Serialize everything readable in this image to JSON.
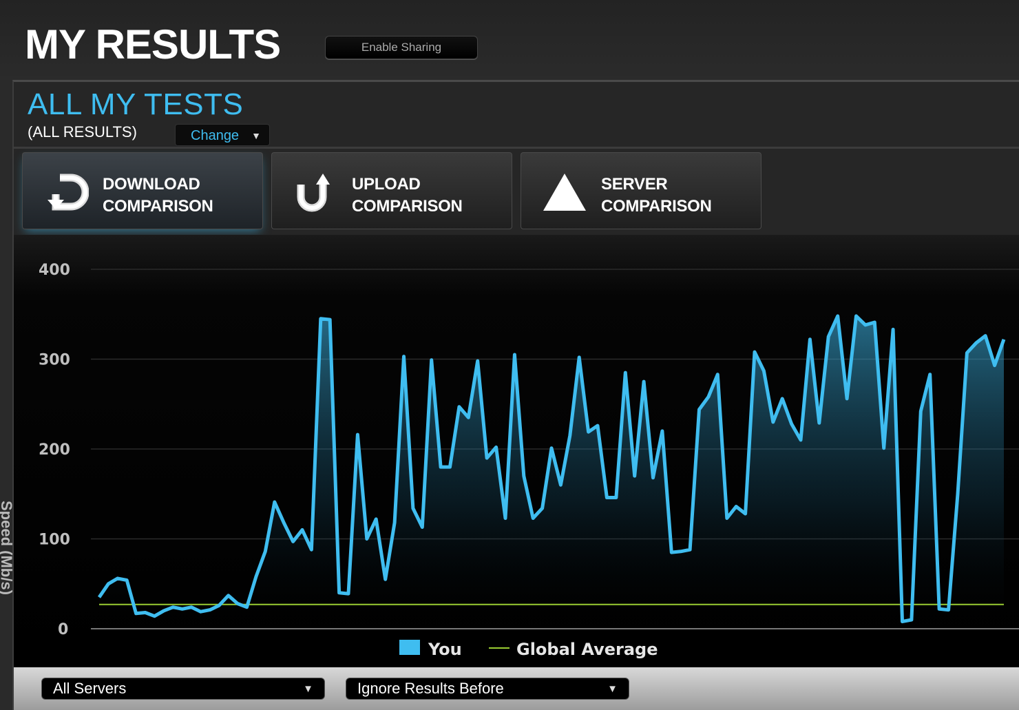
{
  "header": {
    "title": "MY RESULTS",
    "share_label": "Enable Sharing"
  },
  "tests": {
    "title": "ALL MY TESTS",
    "subtitle": "(ALL RESULTS)",
    "change_label": "Change"
  },
  "tabs": [
    {
      "line1": "DOWNLOAD",
      "line2": "COMPARISON",
      "icon": "download-icon"
    },
    {
      "line1": "UPLOAD",
      "line2": "COMPARISON",
      "icon": "upload-icon"
    },
    {
      "line1": "SERVER",
      "line2": "COMPARISON",
      "icon": "triangle-icon"
    }
  ],
  "active_tab": 0,
  "filters": {
    "servers": "All Servers",
    "ignore": "Ignore Results Before"
  },
  "colors": {
    "accent": "#3fbdf0",
    "global_average": "#9acd32"
  },
  "chart_data": {
    "type": "area",
    "ylabel": "Speed (Mb/s)",
    "ylim": [
      0,
      400
    ],
    "yticks": [
      0,
      100,
      200,
      300,
      400
    ],
    "grid": true,
    "legend_position": "bottom",
    "series": [
      {
        "name": "You",
        "values": [
          35,
          50,
          56,
          54,
          17,
          18,
          14,
          20,
          24,
          22,
          24,
          19,
          21,
          26,
          37,
          28,
          24,
          58,
          86,
          141,
          118,
          97,
          110,
          88,
          345,
          344,
          40,
          39,
          216,
          100,
          122,
          55,
          118,
          303,
          134,
          113,
          299,
          180,
          180,
          247,
          235,
          298,
          190,
          202,
          123,
          305,
          170,
          123,
          134,
          201,
          160,
          215,
          302,
          219,
          226,
          146,
          146,
          285,
          170,
          275,
          168,
          220,
          85,
          86,
          88,
          244,
          258,
          283,
          123,
          136,
          128,
          308,
          287,
          230,
          256,
          228,
          210,
          322,
          229,
          325,
          348,
          256,
          348,
          338,
          341,
          201,
          333,
          8,
          10,
          242,
          283,
          22,
          21,
          150,
          307,
          318,
          326,
          293,
          322
        ]
      },
      {
        "name": "Global Average",
        "value": 27
      }
    ]
  }
}
